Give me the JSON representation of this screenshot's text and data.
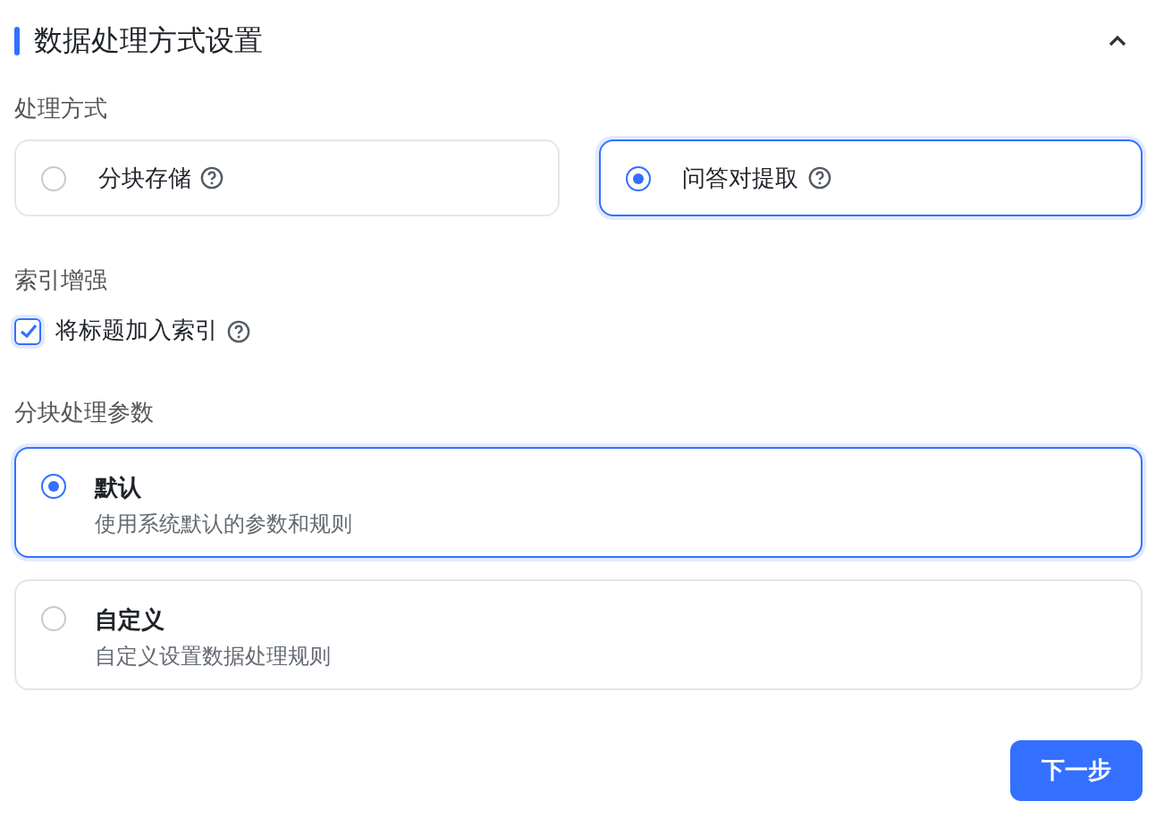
{
  "section": {
    "title": "数据处理方式设置",
    "expanded": true
  },
  "mode": {
    "label": "处理方式",
    "options": [
      {
        "label": "分块存储",
        "selected": false
      },
      {
        "label": "问答对提取",
        "selected": true
      }
    ]
  },
  "index": {
    "label": "索引增强",
    "checkbox": {
      "label": "将标题加入索引",
      "checked": true
    }
  },
  "params": {
    "label": "分块处理参数",
    "options": [
      {
        "title": "默认",
        "description": "使用系统默认的参数和规则",
        "selected": true
      },
      {
        "title": "自定义",
        "description": "自定义设置数据处理规则",
        "selected": false
      }
    ]
  },
  "next_button": "下一步"
}
